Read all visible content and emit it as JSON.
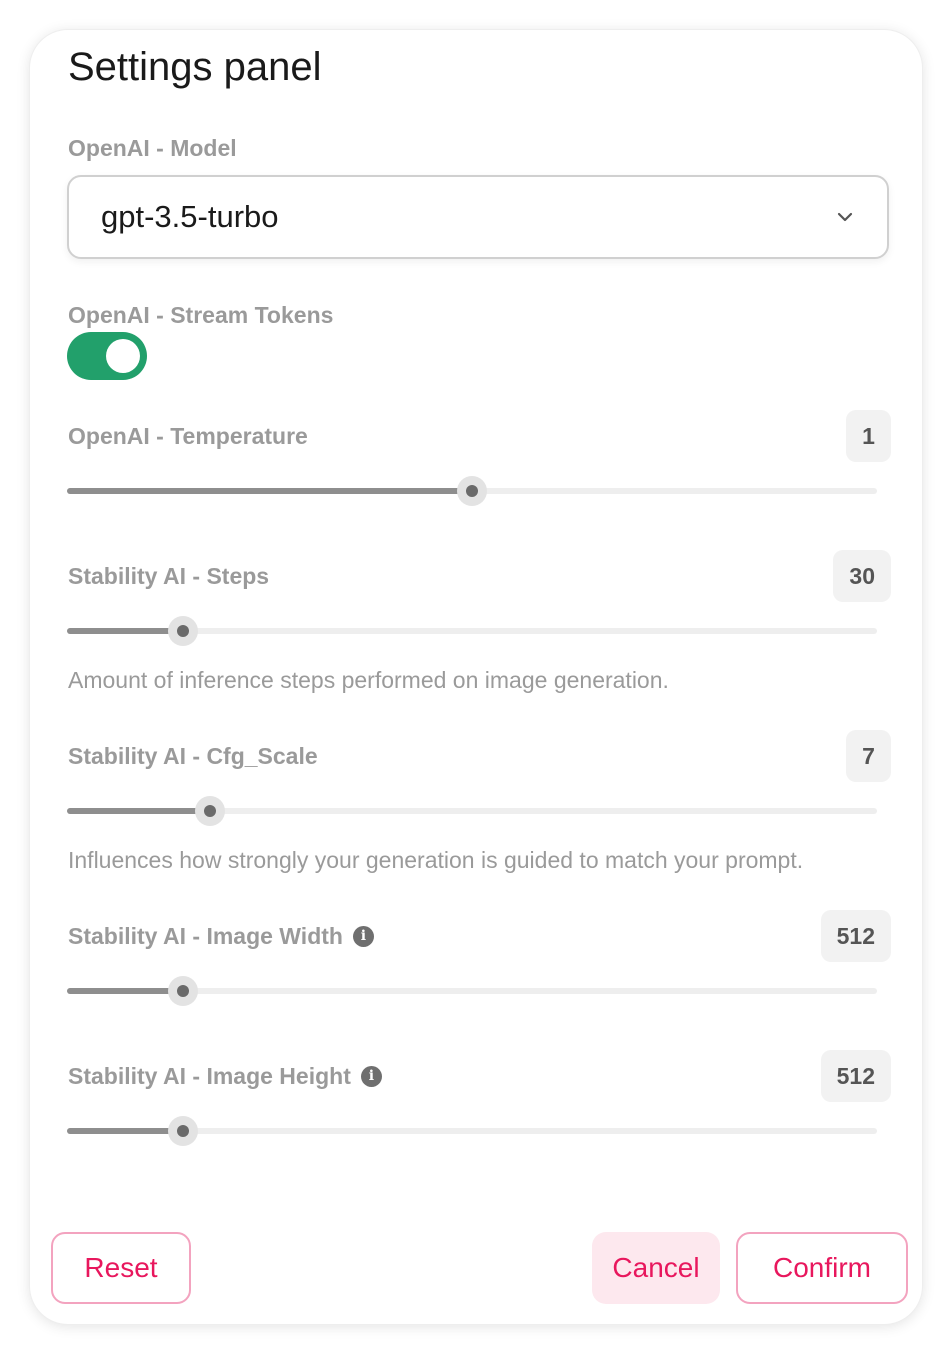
{
  "panel": {
    "title": "Settings panel"
  },
  "model": {
    "label": "OpenAI - Model",
    "selected": "gpt-3.5-turbo"
  },
  "stream": {
    "label": "OpenAI - Stream Tokens",
    "enabled": true,
    "on_color": "#22a06b"
  },
  "sliders": [
    {
      "label": "OpenAI - Temperature",
      "value": "1",
      "fraction": 0.5,
      "description": ""
    },
    {
      "label": "Stability AI - Steps",
      "value": "30",
      "fraction": 0.143,
      "description": "Amount of inference steps performed on image generation."
    },
    {
      "label": "Stability AI - Cfg_Scale",
      "value": "7",
      "fraction": 0.176,
      "description": "Influences how strongly your generation is guided to match your prompt."
    },
    {
      "label": "Stability AI - Image Width",
      "value": "512",
      "fraction": 0.143,
      "description": "",
      "info_icon": "info-icon"
    },
    {
      "label": "Stability AI - Image Height",
      "value": "512",
      "fraction": 0.143,
      "description": "",
      "info_icon": "info-icon"
    }
  ],
  "actions": {
    "reset": "Reset",
    "cancel": "Cancel",
    "confirm": "Confirm",
    "accent_color": "#e8175d"
  }
}
